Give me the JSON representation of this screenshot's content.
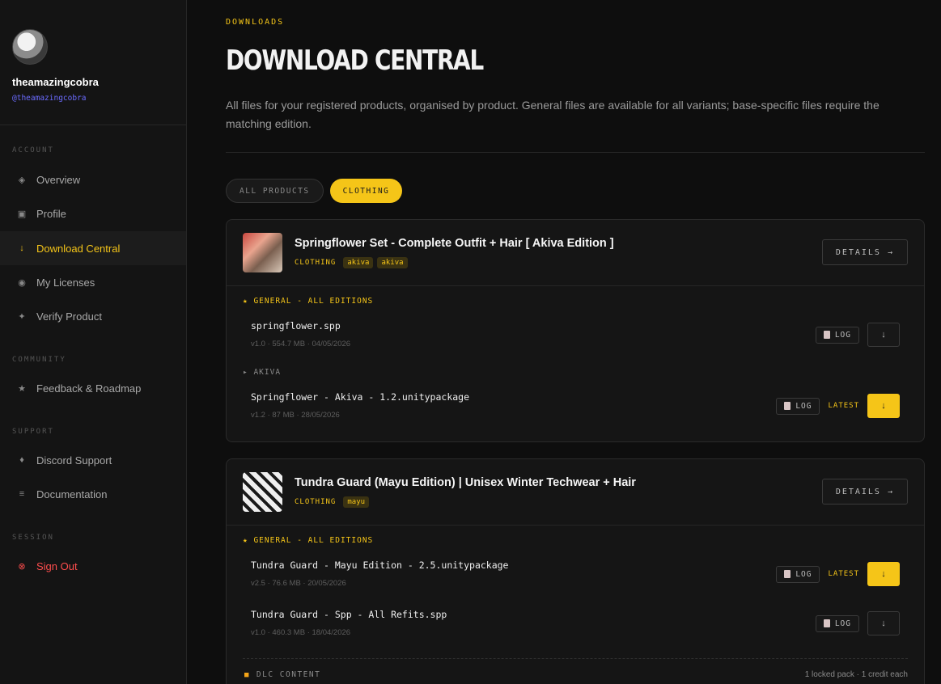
{
  "user": {
    "name": "theamazingcobra",
    "handle": "@theamazingcobra"
  },
  "nav": {
    "sections": [
      "ACCOUNT",
      "COMMUNITY",
      "SUPPORT",
      "SESSION"
    ],
    "items": [
      {
        "label": "Overview",
        "icon": "◈"
      },
      {
        "label": "Profile",
        "icon": "▣"
      },
      {
        "label": "Download Central",
        "icon": "↓"
      },
      {
        "label": "My Licenses",
        "icon": "◉"
      },
      {
        "label": "Verify Product",
        "icon": "✦"
      },
      {
        "label": "Feedback & Roadmap",
        "icon": "★"
      },
      {
        "label": "Discord Support",
        "icon": "♦"
      },
      {
        "label": "Documentation",
        "icon": "≡"
      },
      {
        "label": "Sign Out",
        "icon": "⊗"
      }
    ]
  },
  "page": {
    "eyebrow": "DOWNLOADS",
    "title": "DOWNLOAD CENTRAL",
    "description": "All files for your registered products, organised by product. General files are available for all variants; base-specific files require the matching edition."
  },
  "filters": [
    "ALL PRODUCTS",
    "CLOTHING"
  ],
  "colors": {
    "accent": "#f5c518",
    "danger": "#ff4d4d",
    "handle": "#6b6bff"
  },
  "products": [
    {
      "title": "Springflower Set - Complete Outfit + Hair [ Akiva Edition ]",
      "category": "CLOTHING",
      "tags": [
        "akiva",
        "akiva"
      ],
      "details": "DETAILS →",
      "general_label": "★ GENERAL - ALL EDITIONS",
      "files": [
        {
          "name": "springflower.spp",
          "meta": "v1.0 · 554.7 MB · 04/05/2026",
          "log": "LOG",
          "latest": ""
        }
      ],
      "base_label": "▸ AKIVA",
      "base_files": [
        {
          "name": "Springflower - Akiva - 1.2.unitypackage",
          "meta": "v1.2 · 87 MB · 28/05/2026",
          "log": "LOG",
          "latest": "LATEST"
        }
      ]
    },
    {
      "title": "Tundra Guard (Mayu Edition) | Unisex Winter Techwear + Hair",
      "category": "CLOTHING",
      "tags": [
        "mayu"
      ],
      "details": "DETAILS →",
      "general_label": "★ GENERAL - ALL EDITIONS",
      "files": [
        {
          "name": "Tundra Guard - Mayu Edition - 2.5.unitypackage",
          "meta": "v2.5 · 76.6 MB · 20/05/2026",
          "log": "LOG",
          "latest": "LATEST"
        },
        {
          "name": "Tundra Guard - Spp - All Refits.spp",
          "meta": "v1.0 · 460.3 MB · 18/04/2026",
          "log": "LOG",
          "latest": ""
        }
      ],
      "dlc_label": "DLC CONTENT",
      "dlc_note": "1 locked pack · 1 credit each"
    }
  ],
  "icons": {
    "download": "↓",
    "lock": "lock-icon",
    "log": "log-icon"
  }
}
